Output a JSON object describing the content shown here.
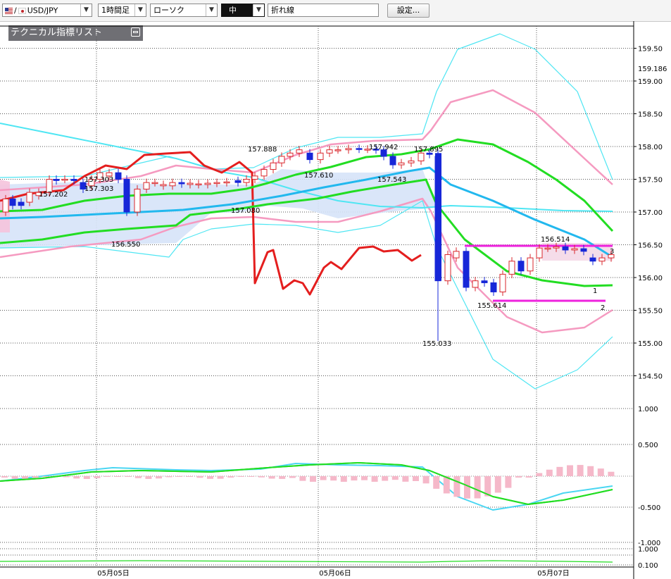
{
  "toolbar": {
    "pair": "USD/JPY",
    "timeframe": "1時間足",
    "chart_type": "ローソク",
    "thickness": "中",
    "line_type": "折れ線",
    "settings_label": "設定..."
  },
  "panel": {
    "title": "テクニカル指標リスト"
  },
  "chart_data": {
    "type": "candlestick",
    "y_ticks": [
      "159.50",
      "159.00",
      "158.50",
      "158.00",
      "157.50",
      "157.00",
      "156.50",
      "156.00",
      "155.50",
      "155.00",
      "154.50"
    ],
    "current_price_label": "159.186",
    "x_ticks": [
      "05月05日",
      "05月06日",
      "05月07日"
    ],
    "annotations": [
      "157.202",
      "157.303",
      "157.303",
      "156.550",
      "157.888",
      "157.080",
      "157.610",
      "157.942",
      "157.543",
      "157.895",
      "155.033",
      "155.614",
      "156.514"
    ],
    "line_markers": [
      "1",
      "2",
      "3"
    ],
    "macd_ticks": [
      "1.000",
      "0.500",
      "-0.500",
      "-1.000"
    ],
    "sub2_ticks": [
      "1.000",
      "0.100"
    ],
    "grid": true,
    "colors": {
      "up": "#d9262b",
      "down": "#1727d8",
      "red_line": "#e41e1e",
      "green": "#22dd22",
      "blue": "#22b8ee",
      "pink": "#f59ac0",
      "cyan": "#4fe6f3",
      "magenta": "#ee22dd",
      "cloud": "#d6e3f8"
    }
  }
}
